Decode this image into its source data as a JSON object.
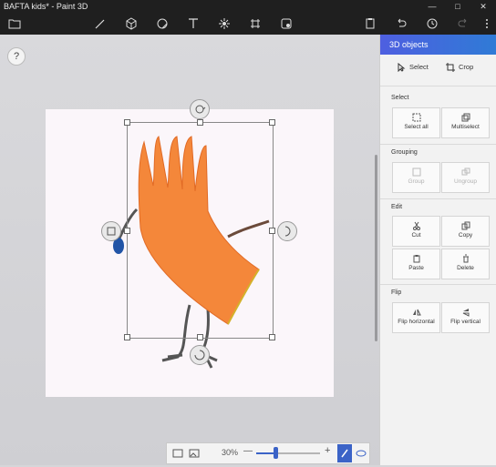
{
  "window": {
    "title": "BAFTA kids* - Paint 3D",
    "minimize": "—",
    "maximize": "□",
    "close": "✕"
  },
  "toolbar": {
    "items": [
      "folder-icon",
      "brush-icon",
      "3d-shapes-icon",
      "stickers-icon",
      "text-icon",
      "effects-icon",
      "canvas-icon",
      "remix-3d-icon",
      "paste-icon",
      "undo-icon",
      "history-icon",
      "redo-icon",
      "more-icon"
    ]
  },
  "help": {
    "label": "?"
  },
  "zoom": {
    "value": "30%",
    "level": 0.3,
    "minus": "—",
    "plus": "+"
  },
  "panel": {
    "title": "3D objects",
    "modes": [
      {
        "label": "Select",
        "icon": "cursor-icon"
      },
      {
        "label": "Crop",
        "icon": "crop-icon"
      }
    ],
    "sections": {
      "select": {
        "heading": "Select",
        "tiles": [
          {
            "label": "Select all",
            "enabled": true
          },
          {
            "label": "Multiselect",
            "enabled": true
          }
        ]
      },
      "grouping": {
        "heading": "Grouping",
        "tiles": [
          {
            "label": "Group",
            "enabled": false
          },
          {
            "label": "Ungroup",
            "enabled": false
          }
        ]
      },
      "edit": {
        "heading": "Edit",
        "tiles": [
          {
            "label": "Cut",
            "enabled": true
          },
          {
            "label": "Copy",
            "enabled": true
          },
          {
            "label": "Paste",
            "enabled": true
          },
          {
            "label": "Delete",
            "enabled": true
          }
        ]
      },
      "flip": {
        "heading": "Flip",
        "tiles": [
          {
            "label": "Flip horizontal",
            "enabled": true
          },
          {
            "label": "Flip vertical",
            "enabled": true
          }
        ]
      }
    }
  },
  "colors": {
    "accent": "#3b63c7",
    "header_start": "#4e5fe0",
    "header_end": "#2f7bd6",
    "figure": "#f4873a"
  }
}
